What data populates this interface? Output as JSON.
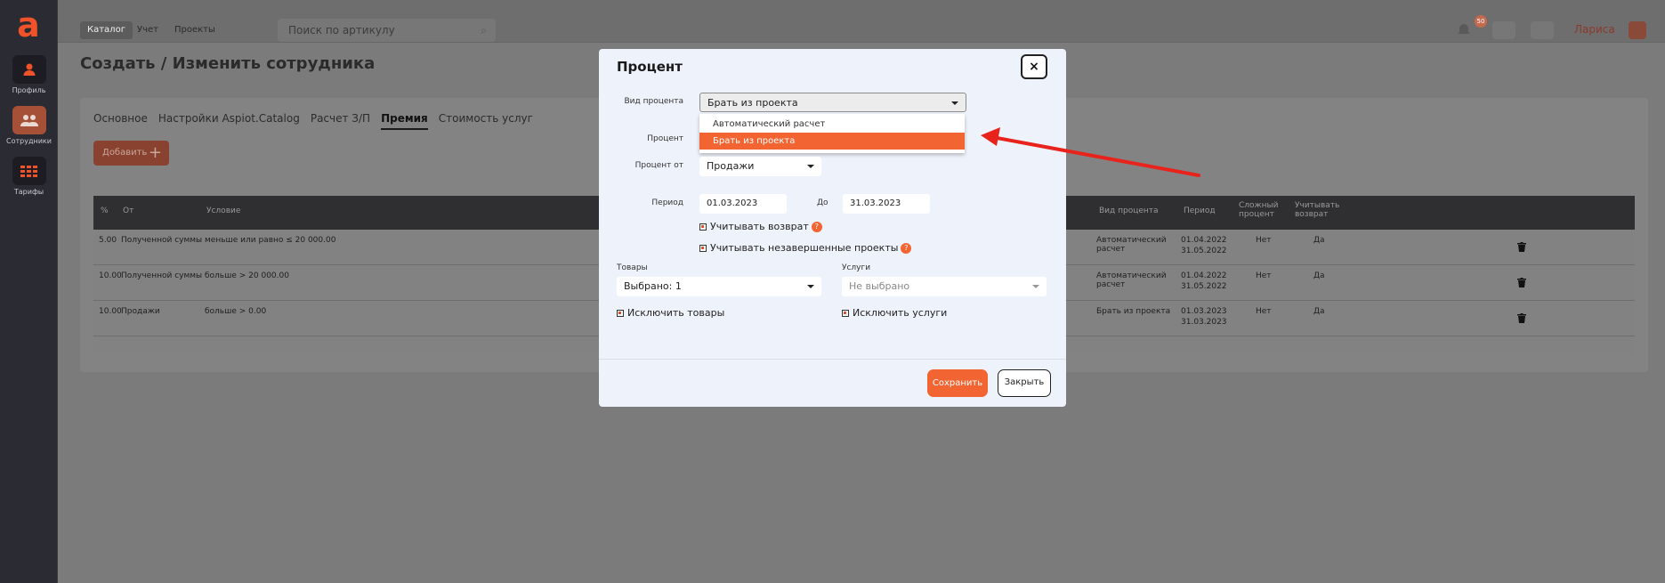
{
  "rail": {
    "logo": "a",
    "items": [
      {
        "label": "Профиль",
        "icon": "user-icon"
      },
      {
        "label": "Сотрудники",
        "icon": "users-icon"
      },
      {
        "label": "Тарифы",
        "icon": "grid-icon"
      }
    ]
  },
  "topbar": {
    "tabs": [
      "Каталог",
      "Учет",
      "Проекты"
    ],
    "search_placeholder": "Поиск по артикулу",
    "notifications_count": "50",
    "user_name": "Лариса"
  },
  "page": {
    "title": "Создать / Изменить сотрудника",
    "tabs": [
      "Основное",
      "Настройки Aspiot.Catalog",
      "Расчет З/П",
      "Премия",
      "Стоимость услуг"
    ],
    "add_label": "Добавить"
  },
  "table": {
    "headers": {
      "pct": "%",
      "from": "От",
      "cond": "Условие",
      "type": "Вид процента",
      "period": "Период",
      "complex": "Сложный процент",
      "returns": "Учитывать возврат"
    },
    "rows": [
      {
        "pct": "5.00",
        "from": "Полученной суммы",
        "cond": "меньше или равно ≤ 20 000.00",
        "type": "Автоматический расчет",
        "period_from": "01.04.2022",
        "period_to": "31.05.2022",
        "complex": "Нет",
        "returns": "Да"
      },
      {
        "pct": "10.00",
        "from": "Полученной суммы",
        "cond": "больше > 20 000.00",
        "type": "Автоматический расчет",
        "period_from": "01.04.2022",
        "period_to": "31.05.2022",
        "complex": "Нет",
        "returns": "Да"
      },
      {
        "pct": "10.00",
        "from": "Продажи",
        "cond": "больше > 0.00",
        "type": "Брать из проекта",
        "period_from": "01.03.2023",
        "period_to": "31.03.2023",
        "complex": "Нет",
        "returns": "Да"
      }
    ]
  },
  "modal": {
    "title": "Процент",
    "close_symbol": "×",
    "type_label": "Вид процента",
    "type_value": "Брать из проекта",
    "type_options": [
      "Автоматический расчет",
      "Брать из проекта"
    ],
    "percent_label": "Процент",
    "percent_from_label": "Процент от",
    "percent_from_value": "Продажи",
    "period_label": "Период",
    "period_from": "01.03.2023",
    "to_label": "До",
    "period_to": "31.03.2023",
    "count_returns": "Учитывать возврат",
    "count_unfinished": "Учитывать незавершенные проекты",
    "help_symbol": "?",
    "goods_label": "Товары",
    "goods_value": "Выбрано: 1",
    "services_label": "Услуги",
    "services_value": "Не выбрано",
    "exclude_goods": "Исключить товары",
    "exclude_services": "Исключить услуги",
    "save_label": "Сохранить",
    "close_label": "Закрыть"
  },
  "colors": {
    "accent": "#f26431",
    "annotation": "#e8231c"
  }
}
